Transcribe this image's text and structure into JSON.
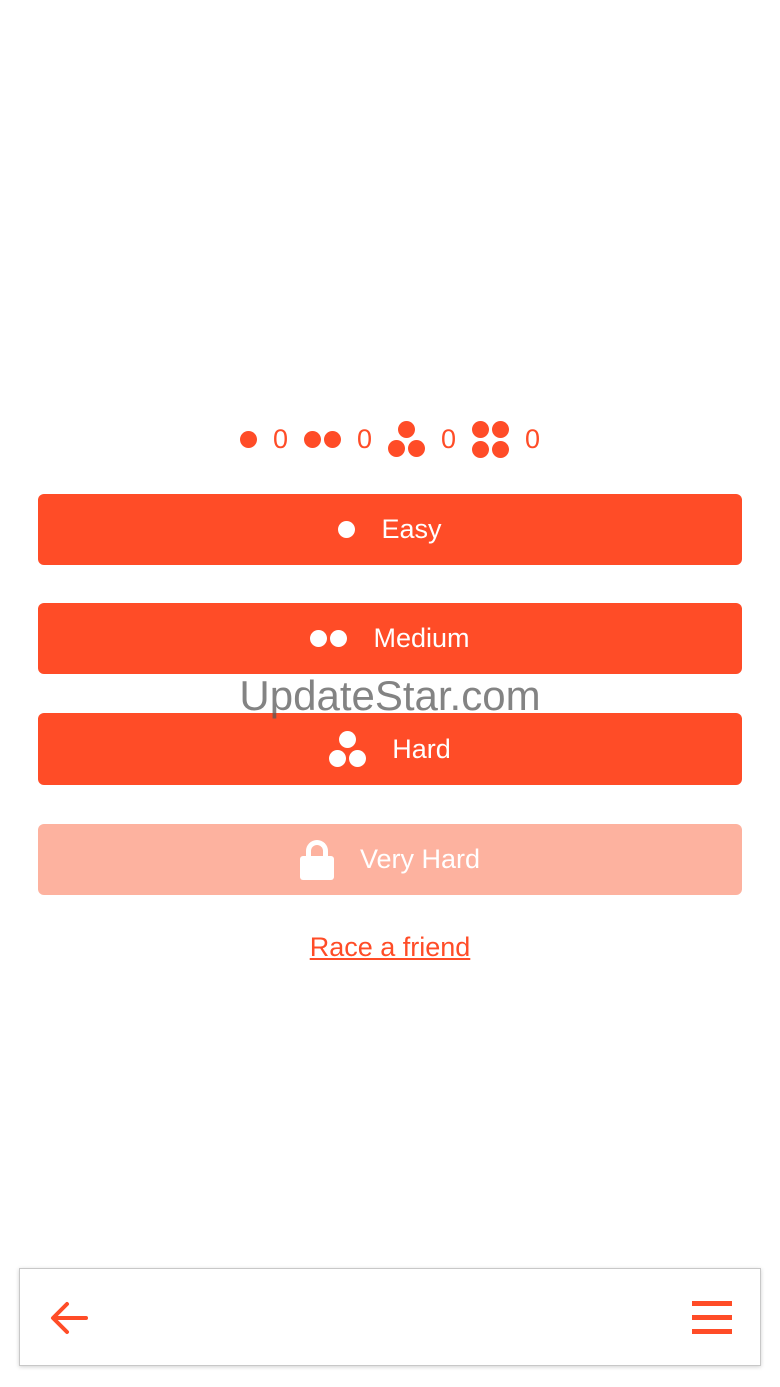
{
  "scores": [
    {
      "icon": "one-dot-icon",
      "value": "0"
    },
    {
      "icon": "two-dots-icon",
      "value": "0"
    },
    {
      "icon": "three-dots-icon",
      "value": "0"
    },
    {
      "icon": "four-dots-icon",
      "value": "0"
    }
  ],
  "difficulty": {
    "easy_label": "Easy",
    "medium_label": "Medium",
    "hard_label": "Hard",
    "very_hard_label": "Very Hard"
  },
  "race_link": "Race a friend",
  "watermark": "UpdateStar.com",
  "colors": {
    "accent": "#ff4c27",
    "locked": "#fdb29f"
  },
  "icons": {
    "back": "arrow-left-icon",
    "menu": "hamburger-menu-icon",
    "lock": "lock-icon"
  }
}
